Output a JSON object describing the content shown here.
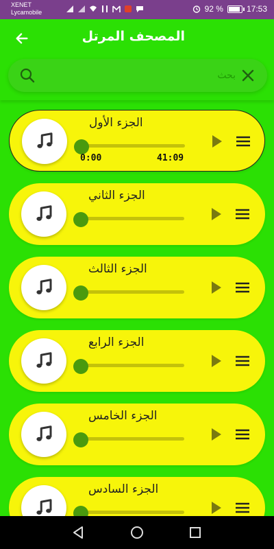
{
  "status_bar": {
    "carrier_line1": "XENET",
    "carrier_line2": "Lycamobile",
    "battery_percent": "92 %",
    "battery_level": 0.92,
    "time": "17:53"
  },
  "app_bar": {
    "title": "المصحف المرتل",
    "back_icon": "arrow-left-icon"
  },
  "search": {
    "placeholder": "بحث",
    "value": ""
  },
  "tracks": [
    {
      "name": "الجزء الأول",
      "active": true,
      "progress": 0,
      "position": "0:00",
      "duration": "41:09"
    },
    {
      "name": "الجزء الثاني",
      "active": false,
      "progress": 0
    },
    {
      "name": "الجزء الثالث",
      "active": false,
      "progress": 0
    },
    {
      "name": "الجزء الرابع",
      "active": false,
      "progress": 0
    },
    {
      "name": "الجزء الخامس",
      "active": false,
      "progress": 0
    },
    {
      "name": "الجزء السادس",
      "active": false,
      "progress": 0
    }
  ],
  "colors": {
    "background": "#2be004",
    "card": "#f7f50a",
    "slider_thumb": "#4a9a0e",
    "status_bar": "#7a3f8c"
  },
  "nav": {
    "back_icon": "nav-back-icon",
    "home_icon": "nav-home-icon",
    "recents_icon": "nav-recents-icon"
  }
}
